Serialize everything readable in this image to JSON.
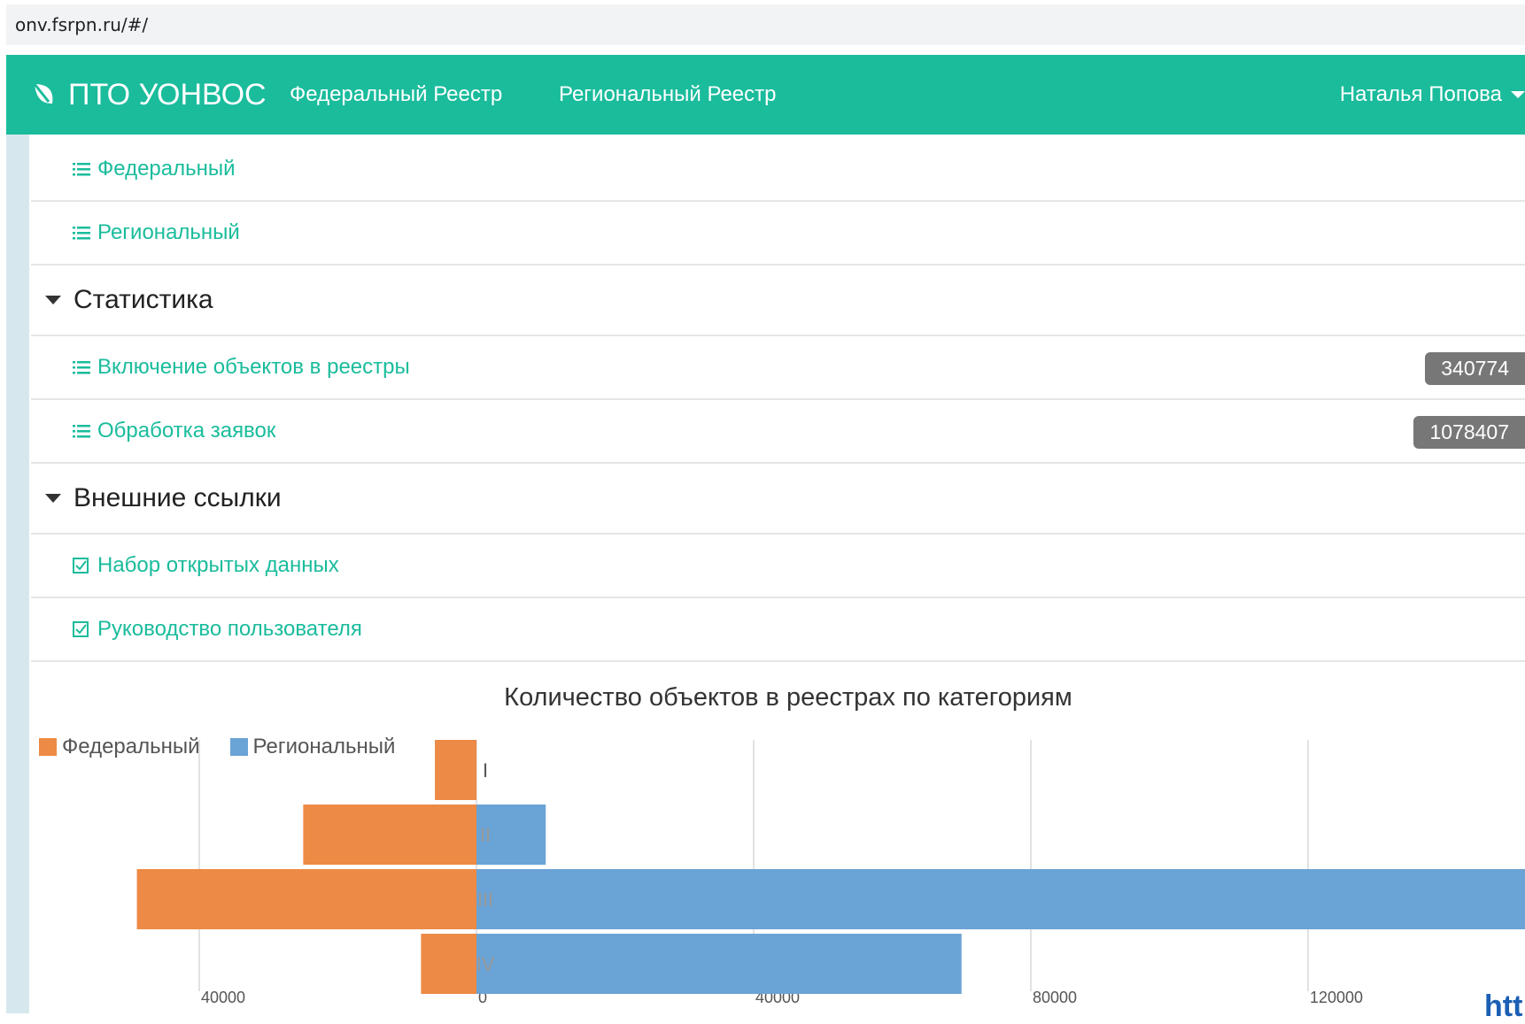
{
  "browser": {
    "url": "onv.fsrpn.ru/#/"
  },
  "navbar": {
    "brand": "ПТО УОНВОС",
    "links": [
      "Федеральный Реестр",
      "Региональный Реестр"
    ],
    "user": "Наталья Попова"
  },
  "sidebar": {
    "items_top": [
      {
        "label": "Федеральный",
        "icon": "list-icon"
      },
      {
        "label": "Региональный",
        "icon": "list-icon"
      }
    ],
    "stats_section": {
      "title": "Статистика"
    },
    "stats_items": [
      {
        "label": "Включение объектов в реестры",
        "icon": "list-icon",
        "badge": "340774"
      },
      {
        "label": "Обработка заявок",
        "icon": "list-icon",
        "badge": "1078407"
      }
    ],
    "links_section": {
      "title": "Внешние ссылки"
    },
    "links_items": [
      {
        "label": "Набор открытых данных",
        "icon": "checkbox-icon"
      },
      {
        "label": "Руководство пользователя",
        "icon": "checkbox-icon"
      }
    ]
  },
  "corner_text": "htt",
  "chart_data": {
    "type": "bar",
    "orientation": "horizontal",
    "title": "Количество объектов в реестрах по категориям",
    "categories": [
      "I",
      "II",
      "III",
      "IV"
    ],
    "series": [
      {
        "name": "Федеральный",
        "color": "#ed8a45",
        "values": [
          6000,
          25000,
          49000,
          8000
        ]
      },
      {
        "name": "Региональный",
        "color": "#6aa3d5",
        "values": [
          0,
          10000,
          165000,
          70000
        ]
      }
    ],
    "x_ticks": [
      "40000",
      "0",
      "40000",
      "80000",
      "120000"
    ],
    "legend_position": "top-left",
    "grid": true
  }
}
